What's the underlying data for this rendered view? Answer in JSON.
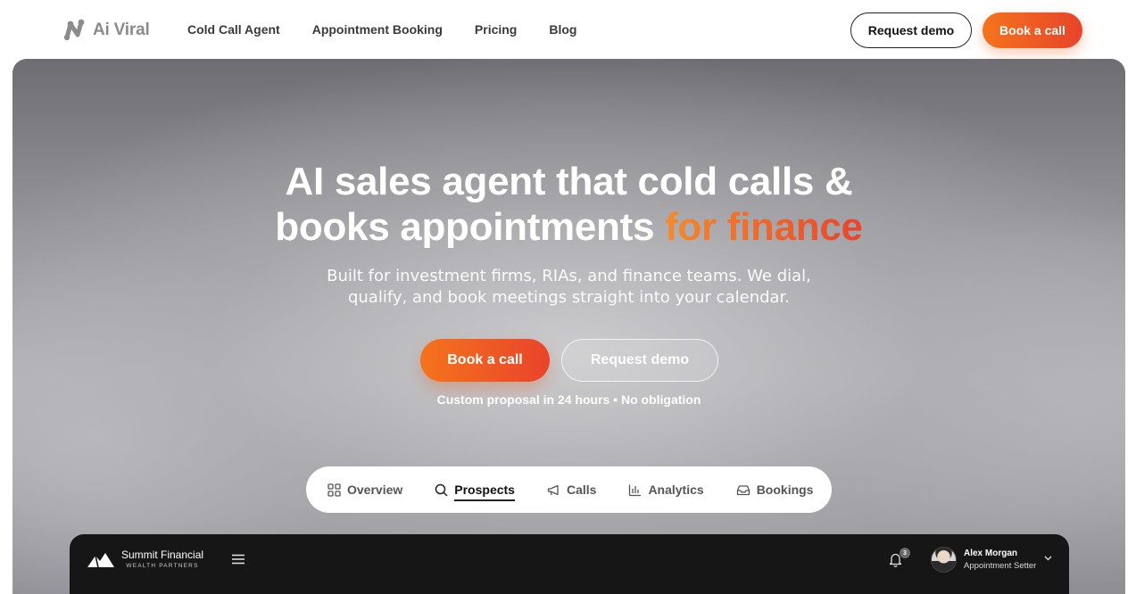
{
  "nav": {
    "logo_text": "Ai Viral",
    "links": [
      "Cold Call Agent",
      "Appointment Booking",
      "Pricing",
      "Blog"
    ],
    "request_demo_label": "Request demo",
    "book_call_label": "Book a call"
  },
  "hero": {
    "headline_line1": "AI sales agent that cold calls &",
    "headline_line2_plain": "books appointments ",
    "headline_line2_accent": "for finance",
    "subtext_line1": "Built for investment firms, RIAs, and finance teams. We dial,",
    "subtext_line2": "qualify, and book meetings straight into your calendar.",
    "book_call_label": "Book a call",
    "request_demo_label": "Request demo",
    "fineprint": "Custom proposal in 24 hours • No obligation"
  },
  "tabs": [
    {
      "label": "Overview",
      "icon": "grid-icon",
      "active": false
    },
    {
      "label": "Prospects",
      "icon": "search-icon",
      "active": true
    },
    {
      "label": "Calls",
      "icon": "megaphone-icon",
      "active": false
    },
    {
      "label": "Analytics",
      "icon": "bar-chart-icon",
      "active": false
    },
    {
      "label": "Bookings",
      "icon": "inbox-icon",
      "active": false
    }
  ],
  "dashboard": {
    "brand_name": "Summit Financial",
    "brand_sub": "WEALTH PARTNERS",
    "notification_count": "3",
    "user_name": "Alex Morgan",
    "user_role": "Appointment Setter"
  },
  "colors": {
    "accent_start": "#f4731c",
    "accent_end": "#e8442b",
    "dashboard_bg": "#161616"
  }
}
